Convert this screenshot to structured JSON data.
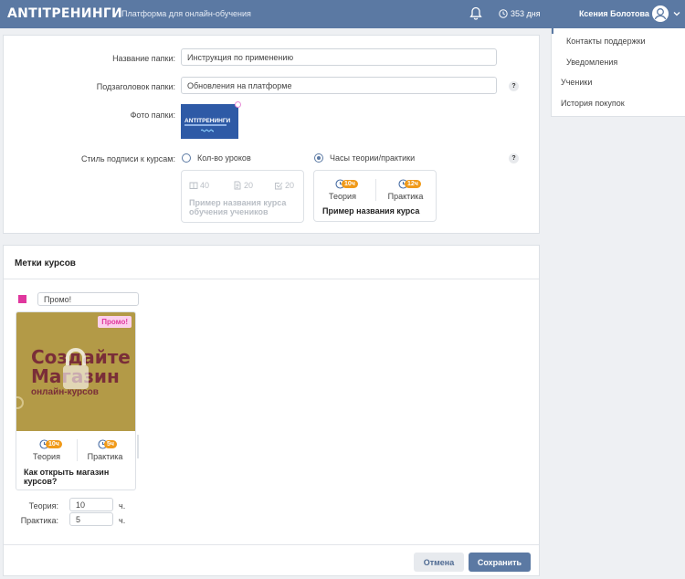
{
  "header": {
    "logo": "ANTITРЕНИНГИ",
    "tagline": "Платформа для онлайн-обучения",
    "days": "353 дня",
    "user_name": "Ксения Болотова"
  },
  "sidebar": {
    "items": [
      {
        "label": "Контакты поддержки"
      },
      {
        "label": "Уведомления"
      },
      {
        "label": "Ученики"
      },
      {
        "label": "История покупок"
      }
    ]
  },
  "folder_form": {
    "name_label": "Название папки:",
    "name_value": "Инструкция по применению",
    "subtitle_label": "Подзаголовок папки:",
    "subtitle_value": "Обновления на платформе",
    "photo_label": "Фото папки:",
    "photo_logo": "ANTITРЕНИНГИ",
    "style_label": "Стиль подписи к курсам:",
    "help": "?",
    "style_options": [
      {
        "label": "Кол-во уроков",
        "selected": false
      },
      {
        "label": "Часы теории/практики",
        "selected": true
      }
    ],
    "sample_lessons": {
      "stats": [
        "40",
        "20",
        "20"
      ],
      "title": "Пример названия курса обучения учеников"
    },
    "sample_hours": {
      "theory_badge": "10ч",
      "theory_label": "Теория",
      "practice_badge": "12ч",
      "practice_label": "Практика",
      "title": "Пример названия курса"
    }
  },
  "course_tags": {
    "title": "Метки курсов",
    "tag_color": "#e0379e",
    "tag_value": "Промо!",
    "card": {
      "promo_badge": "Промо!",
      "cover_line1": "Создайте",
      "cover_line2": "Магазин",
      "cover_line3": "онлайн-курсов",
      "theory_badge": "10ч",
      "theory_label": "Теория",
      "practice_badge": "5ч",
      "practice_label": "Практика",
      "title": "Как открыть магазин курсов?"
    },
    "theory_label": "Теория:",
    "theory_value": "10",
    "practice_label": "Практика:",
    "practice_value": "5",
    "unit": "ч."
  },
  "actions": {
    "cancel": "Отмена",
    "save": "Сохранить"
  }
}
